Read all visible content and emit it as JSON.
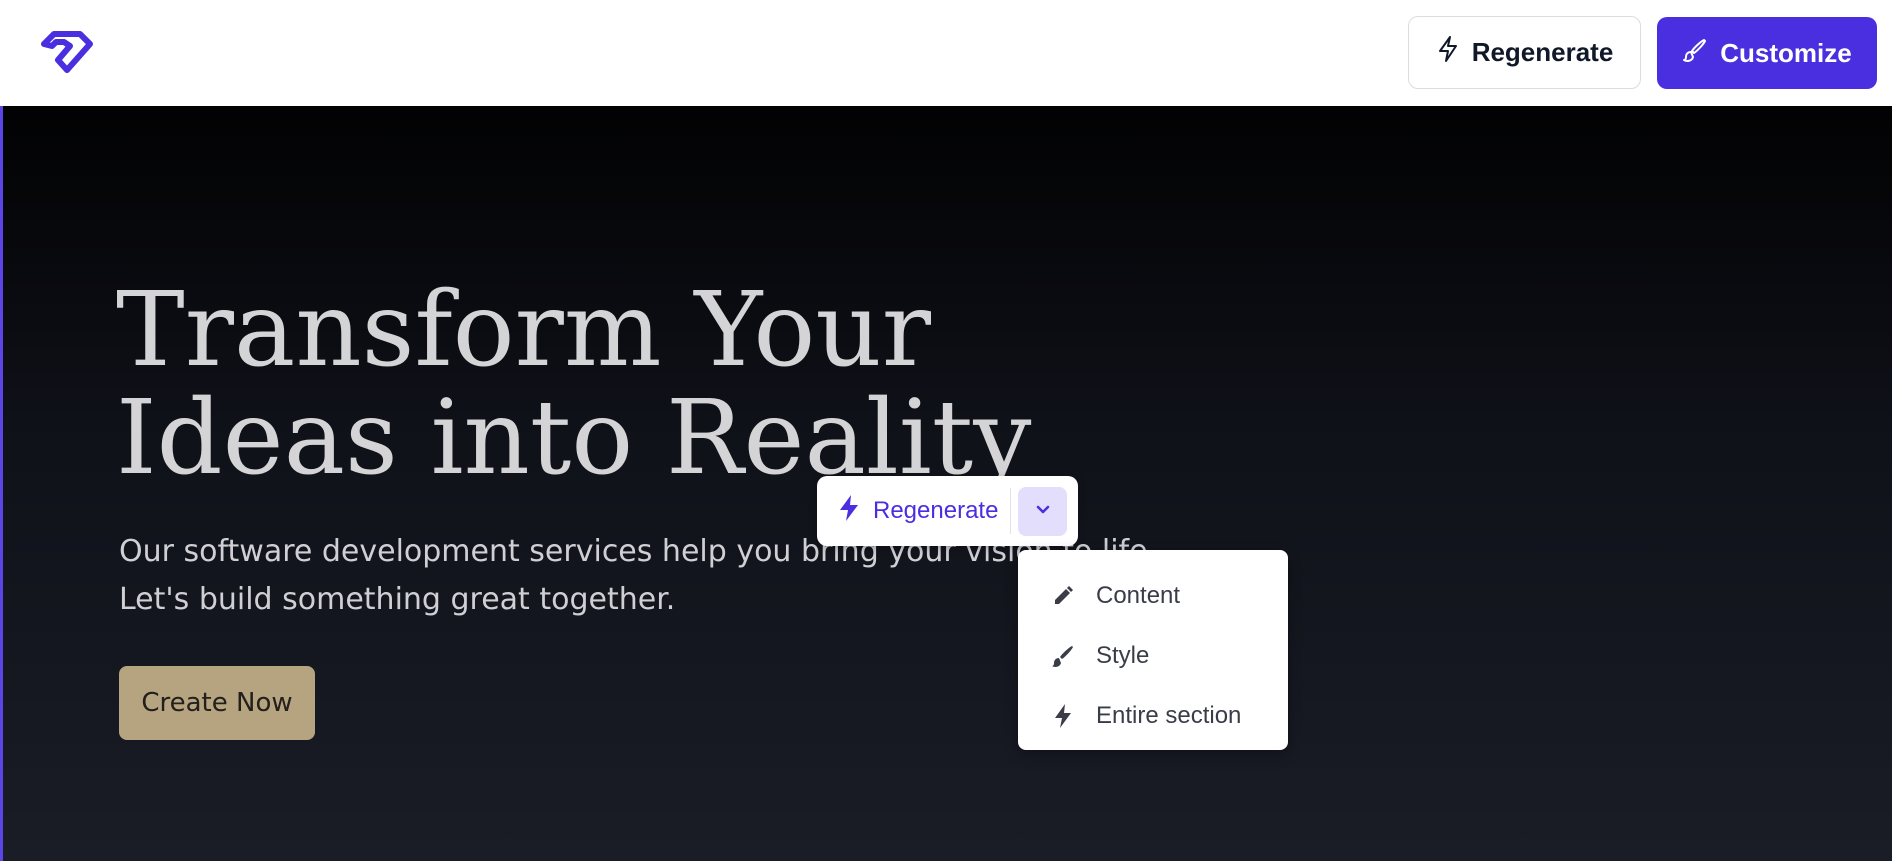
{
  "header": {
    "logo": "diamond-logo",
    "regenerate_label": "Regenerate",
    "customize_label": "Customize"
  },
  "hero": {
    "title_lines": [
      "Transform Your",
      "Ideas into Reality"
    ],
    "subtitle_lines": [
      "Our software development services help you bring your vision to life.",
      "Let's build something great together."
    ],
    "cta_label": "Create Now"
  },
  "section_toolbar": {
    "regenerate_label": "Regenerate",
    "menu_items": [
      {
        "icon": "pencil-icon",
        "label": "Content"
      },
      {
        "icon": "brush-icon",
        "label": "Style"
      },
      {
        "icon": "bolt-icon",
        "label": "Entire section"
      }
    ]
  },
  "colors": {
    "accent": "#4a2fe0",
    "cta": "#b6a380",
    "hero_bg_top": "#020203",
    "hero_bg_bottom": "#1a1c26"
  }
}
